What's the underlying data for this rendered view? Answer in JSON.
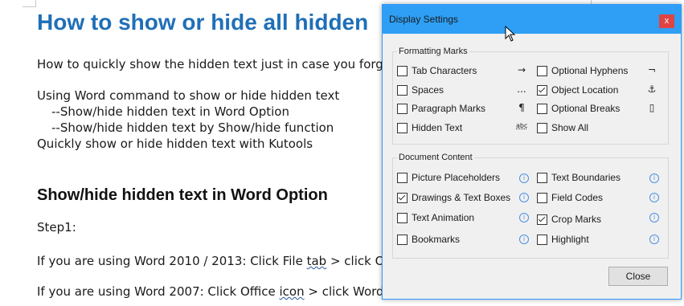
{
  "article": {
    "title": "How to show or hide all hidden",
    "intro": "How to quickly show the hidden text just in case you forget they a",
    "toc": [
      "Using Word command to show or hide hidden text",
      "--Show/hide hidden text in Word Option",
      "--Show/hide hidden text by Show/hide function",
      "Quickly show or hide hidden text with Kutools"
    ],
    "section_heading": "Show/hide hidden text in Word Option",
    "step1": "Step1:",
    "line_2010_a": "If you are using Word 2010 / 2013: Click File ",
    "line_2010_tab": "tab",
    "line_2010_b": " > click Options",
    "line_2007_a": "If you are using Word 2007: Click Office ",
    "line_2007_icon": "icon",
    "line_2007_b": " > click Word Options"
  },
  "dialog": {
    "title": "Display Settings",
    "close_x": "x",
    "formatting_label": "Formatting Marks",
    "formatting_left": [
      {
        "label": "Tab Characters",
        "checked": false,
        "symbol": "→"
      },
      {
        "label": "Spaces",
        "checked": false,
        "symbol": "..."
      },
      {
        "label": "Paragraph Marks",
        "checked": false,
        "symbol": "¶"
      },
      {
        "label": "Hidden Text",
        "checked": false,
        "symbol": "abc"
      }
    ],
    "formatting_right": [
      {
        "label": "Optional Hyphens",
        "checked": false,
        "symbol": "¬"
      },
      {
        "label": "Object Location",
        "checked": true,
        "symbol": "⚓"
      },
      {
        "label": "Optional Breaks",
        "checked": false,
        "symbol": "▯"
      },
      {
        "label": "Show All",
        "checked": false,
        "symbol": ""
      }
    ],
    "content_label": "Document Content",
    "content_left": [
      {
        "label": "Picture Placeholders",
        "checked": false
      },
      {
        "label": "Drawings & Text Boxes",
        "checked": true
      },
      {
        "label": "Text Animation",
        "checked": false
      },
      {
        "label": "Bookmarks",
        "checked": false
      }
    ],
    "content_right": [
      {
        "label": "Text Boundaries",
        "checked": false
      },
      {
        "label": "Field Codes",
        "checked": false
      },
      {
        "label": "Crop Marks",
        "checked": true
      },
      {
        "label": "Highlight",
        "checked": false
      }
    ],
    "info_glyph": "i",
    "close_button": "Close",
    "colors": {
      "titlebar": "#2e9ff4",
      "close_x_bg": "#e04343",
      "heading": "#1f6fb7"
    }
  }
}
